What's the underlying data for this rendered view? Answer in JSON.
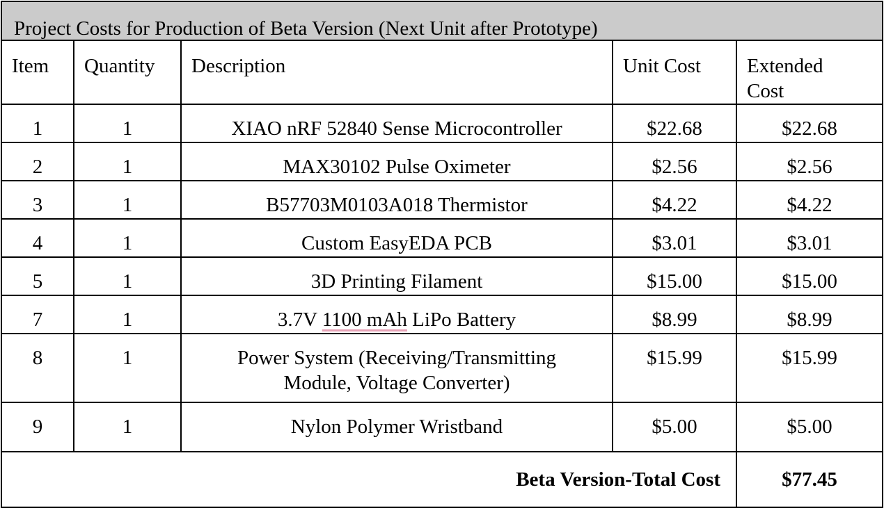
{
  "table": {
    "title": "Project Costs for Production of Beta Version (Next Unit after Prototype)",
    "headers": {
      "item": "Item",
      "quantity": "Quantity",
      "description": "Description",
      "unit_cost": "Unit Cost",
      "extended_cost": "Extended Cost"
    },
    "rows": [
      {
        "item": "1",
        "quantity": "1",
        "description": "XIAO nRF 52840 Sense Microcontroller",
        "unit_cost": "$22.68",
        "extended_cost": "$22.68"
      },
      {
        "item": "2",
        "quantity": "1",
        "description": "MAX30102 Pulse Oximeter",
        "unit_cost": "$2.56",
        "extended_cost": "$2.56"
      },
      {
        "item": "3",
        "quantity": "1",
        "description": "B57703M0103A018 Thermistor",
        "unit_cost": "$4.22",
        "extended_cost": "$4.22"
      },
      {
        "item": "4",
        "quantity": "1",
        "description": "Custom EasyEDA PCB",
        "unit_cost": "$3.01",
        "extended_cost": "$3.01"
      },
      {
        "item": "5",
        "quantity": "1",
        "description": "3D Printing Filament",
        "unit_cost": "$15.00",
        "extended_cost": "$15.00"
      },
      {
        "item": "7",
        "quantity": "1",
        "description_parts": {
          "before": "3.7V ",
          "marked": "1100 mAh",
          "after": " LiPo Battery"
        },
        "unit_cost": "$8.99",
        "extended_cost": "$8.99"
      },
      {
        "item": "8",
        "quantity": "1",
        "description": "Power System (Receiving/Transmitting Module, Voltage Converter)",
        "unit_cost": "$15.99",
        "extended_cost": "$15.99"
      },
      {
        "item": "9",
        "quantity": "1",
        "description": "Nylon Polymer Wristband",
        "unit_cost": "$5.00",
        "extended_cost": "$5.00"
      }
    ],
    "total": {
      "label": "Beta Version-Total Cost",
      "value": "$77.45"
    }
  }
}
